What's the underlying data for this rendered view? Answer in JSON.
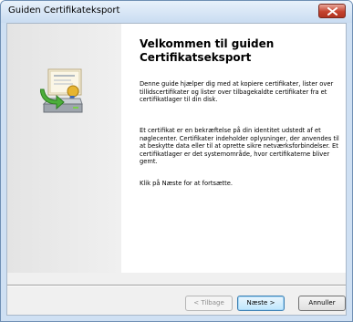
{
  "window": {
    "title": "Guiden Certifikateksport"
  },
  "welcome": {
    "heading": "Velkommen til guiden Certifikatseksport",
    "paragraph1": "Denne guide hjælper dig med at kopiere certifikater, lister over tillidscertifikater og lister over tilbagekaldte certifikater fra et certifikatlager til din disk.",
    "paragraph2": "Et certifikat er en bekræftelse på din identitet udstedt af et nøglecenter. Certifikater indeholder oplysninger, der anvendes til at beskytte data eller til at oprette sikre netværksforbindelser. Et certifikatlager er det systemområde, hvor certifikaterne bliver gemt.",
    "paragraph3": "Klik på Næste for at fortsætte."
  },
  "buttons": {
    "back": "< Tilbage",
    "next": "Næste >",
    "cancel": "Annuller"
  },
  "icons": {
    "close": "close-icon",
    "wizard": "certificate-export-icon"
  }
}
